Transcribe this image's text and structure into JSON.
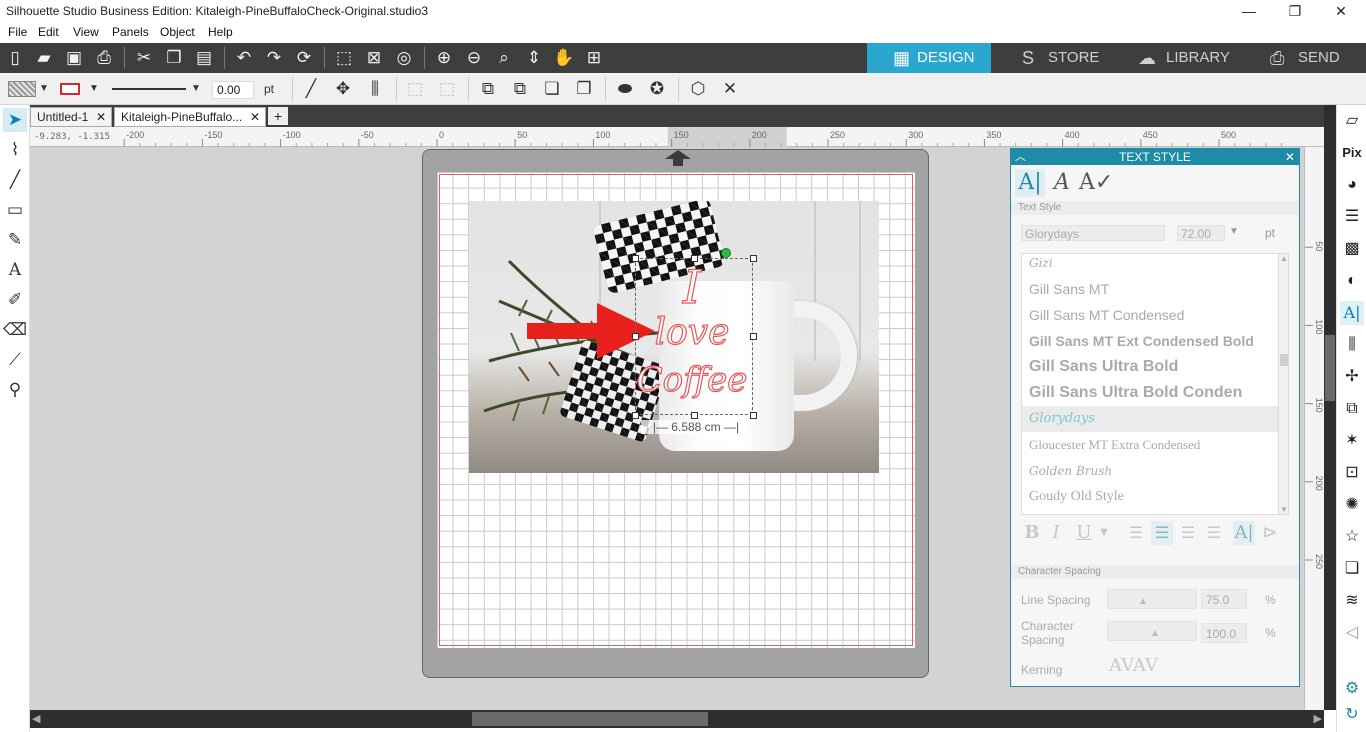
{
  "window": {
    "title": "Silhouette Studio Business Edition: Kitaleigh-PineBuffaloCheck-Original.studio3",
    "minimize": "—",
    "restore": "❐",
    "close": "✕"
  },
  "menu": [
    "File",
    "Edit",
    "View",
    "Panels",
    "Object",
    "Help"
  ],
  "nav_tabs": [
    {
      "label": "DESIGN",
      "icon": "▦"
    },
    {
      "label": "STORE",
      "icon": "S"
    },
    {
      "label": "LIBRARY",
      "icon": "☁"
    },
    {
      "label": "SEND",
      "icon": "⎙"
    }
  ],
  "toolbar2": {
    "line_width": "0.00",
    "line_unit": "pt"
  },
  "doc_tabs": [
    "Untitled-1",
    "Kitaleigh-PineBuffalo..."
  ],
  "add_tab": "+",
  "tab_close": "✕",
  "ruler": {
    "coord_readout": "-9.283, -1.315",
    "h_ticks": [
      "-200",
      "-150",
      "-100",
      "-50",
      "0",
      "50",
      "100",
      "150",
      "200",
      "250",
      "300",
      "350",
      "400",
      "450",
      "500"
    ],
    "v_ticks": [
      "50",
      "100",
      "150",
      "200",
      "250"
    ]
  },
  "canvas": {
    "mug_text": [
      "I",
      "love",
      "Coffee"
    ],
    "dimension_label": "|— 6.588 cm —|",
    "accent_red": "#e8201c"
  },
  "text_style_panel": {
    "title": "TEXT STYLE",
    "section_text_style": "Text Style",
    "font_name": "Glorydays",
    "font_size": "72.00",
    "size_unit": "pt",
    "fonts": [
      "Gizi",
      "Gill Sans MT",
      "Gill Sans MT Condensed",
      "Gill Sans MT Ext Condensed Bold",
      "Gill Sans Ultra Bold",
      "Gill Sans Ultra Bold Conden",
      "Glorydays",
      "Gloucester MT Extra Condensed",
      "Golden Brush",
      "Goudy Old Style"
    ],
    "selected_font_index": 6,
    "section_char_spacing": "Character Spacing",
    "line_spacing_label": "Line Spacing",
    "line_spacing_value": "75.0",
    "char_spacing_label_1": "Character",
    "char_spacing_label_2": "Spacing",
    "char_spacing_value": "100.0",
    "percent": "%",
    "kerning_label": "Kerning",
    "kerning_icon": "AVAV",
    "accent": "#1e8ca6"
  }
}
